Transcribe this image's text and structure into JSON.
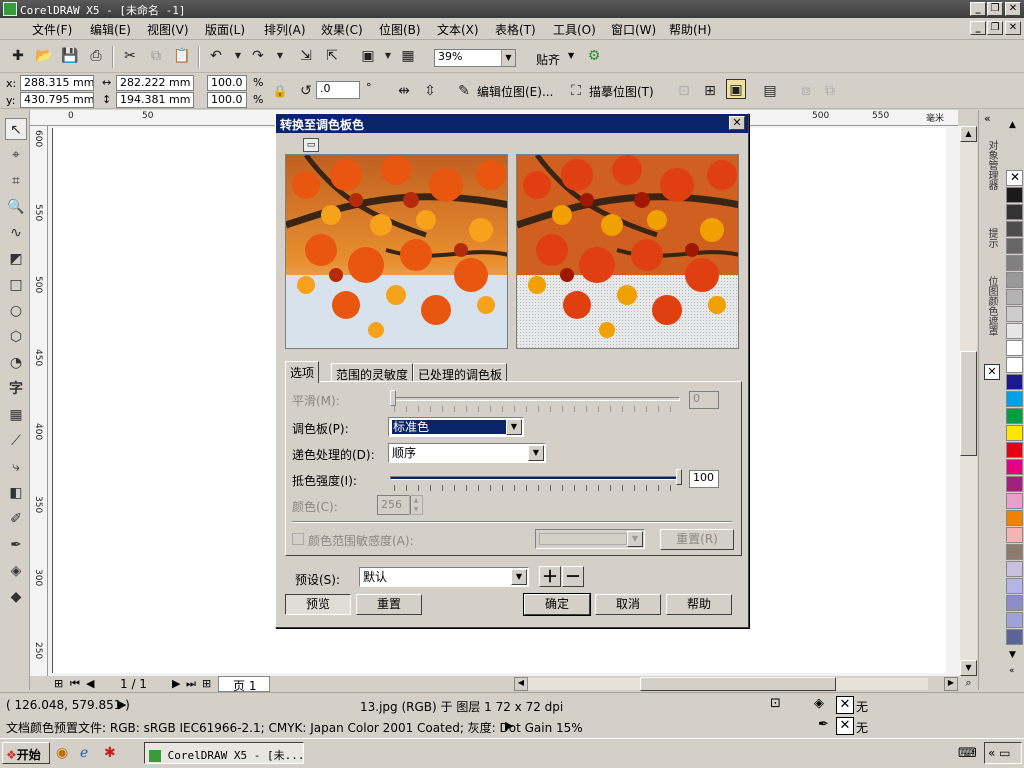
{
  "window": {
    "title": "CorelDRAW X5 - [未命名 -1]"
  },
  "menu": [
    "文件(F)",
    "编辑(E)",
    "视图(V)",
    "版面(L)",
    "排列(A)",
    "效果(C)",
    "位图(B)",
    "文本(X)",
    "表格(T)",
    "工具(O)",
    "窗口(W)",
    "帮助(H)"
  ],
  "toolbar": {
    "zoom": "39%",
    "snap_label": "贴齐"
  },
  "propbar": {
    "x_label": "x:",
    "x_value": "288.315 mm",
    "y_label": "y:",
    "y_value": "430.795 mm",
    "w_value": "282.222 mm",
    "h_value": "194.381 mm",
    "scale_x": "100.0",
    "scale_y": "100.0",
    "percent": "%",
    "rotation": ".0",
    "degree": "°",
    "edit_bitmap": "编辑位图(E)...",
    "trace_bitmap": "描摹位图(T)"
  },
  "ruler": {
    "unit": "毫米",
    "h_ticks": [
      "0",
      "50",
      "500",
      "550"
    ],
    "v_ticks": [
      "600",
      "550",
      "500",
      "450",
      "400",
      "350",
      "300",
      "250"
    ]
  },
  "dialog": {
    "title": "转换至调色板色",
    "tabs": [
      "选项",
      "范围的灵敏度",
      "已处理的调色板"
    ],
    "smooth_label": "平滑(M):",
    "smooth_value": "0",
    "palette_label": "调色板(P):",
    "palette_value": "标准色",
    "dither_label": "递色处理的(D):",
    "dither_value": "顺序",
    "dither_strength_label": "抵色强度(I):",
    "dither_strength_value": "100",
    "colors_label": "颜色(C):",
    "colors_value": "256",
    "range_sensitivity_label": "颜色范围敏感度(A):",
    "reset_small": "重置(R)",
    "preset_label": "预设(S):",
    "preset_value": "默认",
    "preview_btn": "预览",
    "reset_btn": "重置",
    "ok_btn": "确定",
    "cancel_btn": "取消",
    "help_btn": "帮助"
  },
  "pager": {
    "position": "1 / 1",
    "page_tab": "页 1"
  },
  "status": {
    "coords": "( 126.048, 579.851 )",
    "object_info": "13.jpg (RGB) 于 图层 1 72 x 72 dpi",
    "profile": "文档颜色预置文件: RGB: sRGB IEC61966-2.1; CMYK: Japan Color 2001 Coated; 灰度: Dot Gain 15%",
    "fill_none": "无",
    "outline_none": "无"
  },
  "docker": {
    "tab1": "对象管理器",
    "tab2": "提示",
    "tab3": "位图颜色遮罩"
  },
  "taskbar": {
    "start": "开始",
    "task": "CorelDRAW X5 - [未..."
  },
  "colors": {
    "palette": [
      "#ffffff",
      "#1a1a1a",
      "#333333",
      "#4d4d4d",
      "#666666",
      "#808080",
      "#999999",
      "#b3b3b3",
      "#cccccc",
      "#e6e6e6",
      "#ffffff",
      "#1b1a8c",
      "#00a0e9",
      "#00a040",
      "#ffe600",
      "#e60012",
      "#e4007f",
      "#a0227e",
      "#e8a0c8",
      "#f08200",
      "#f4b4b4",
      "#8c7b6e",
      "#c8c0e0",
      "#b4b4e6",
      "#8c8cc8",
      "#a0a0dc",
      "#5a6496"
    ],
    "dialog_title_bg": "#0a246a"
  }
}
